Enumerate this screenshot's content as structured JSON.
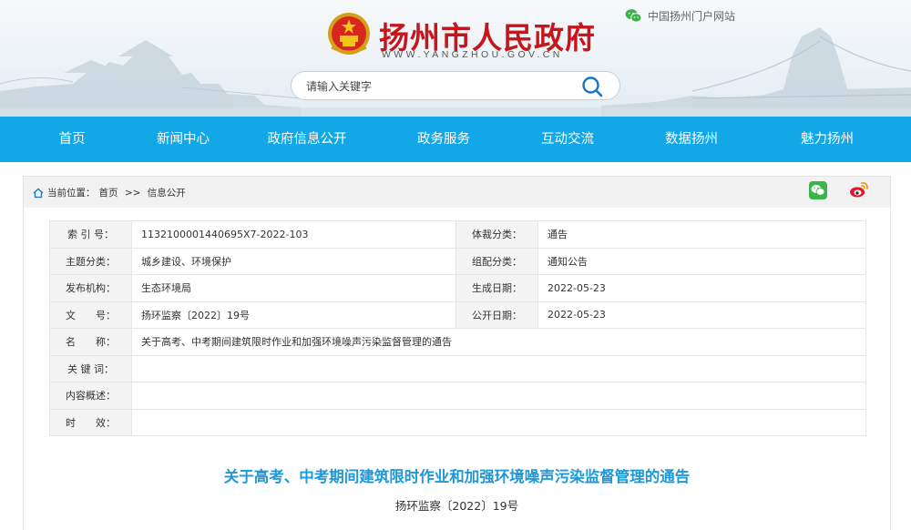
{
  "header": {
    "site_title": "扬州市人民政府",
    "site_url": "WWW.YANGZHOU.GOV.CN",
    "portal_link": "中国扬州门户网站",
    "search_placeholder": "请输入关键字"
  },
  "nav": [
    "首页",
    "新闻中心",
    "政府信息公开",
    "政务服务",
    "互动交流",
    "数据扬州",
    "魅力扬州"
  ],
  "breadcrumb": {
    "prefix": "当前位置：",
    "home": "首页",
    "sep": " >> ",
    "current": "信息公开"
  },
  "meta": {
    "index_label": "索 引 号：",
    "index_value": "1132100001440695X7-2022-103",
    "genre_label": "体裁分类：",
    "genre_value": "通告",
    "topic_label": "主题分类：",
    "topic_value": "城乡建设、环境保护",
    "config_label": "组配分类：",
    "config_value": "通知公告",
    "issuer_label": "发布机构：",
    "issuer_value": "生态环境局",
    "created_label": "生成日期：",
    "created_value": "2022-05-23",
    "docno_label": "文　　号：",
    "docno_value": "扬环监察〔2022〕19号",
    "published_label": "公开日期：",
    "published_value": "2022-05-23",
    "name_label": "名　　称：",
    "name_value": "关于高考、中考期间建筑限时作业和加强环境噪声污染监督管理的通告",
    "keywords_label": "关 键 词：",
    "keywords_value": "",
    "summary_label": "内容概述：",
    "summary_value": "",
    "validity_label": "时　　效：",
    "validity_value": ""
  },
  "article": {
    "title": "关于高考、中考期间建筑限时作业和加强环境噪声污染监督管理的通告",
    "doc_number": "扬环监察〔2022〕19号"
  },
  "colors": {
    "nav_bg": "#12a8e8",
    "title_red": "#c4161c",
    "doc_title_blue": "#1e98d6"
  },
  "icons": [
    "national-emblem-icon",
    "wechat-icon",
    "search-icon",
    "home-icon",
    "weibo-icon"
  ]
}
